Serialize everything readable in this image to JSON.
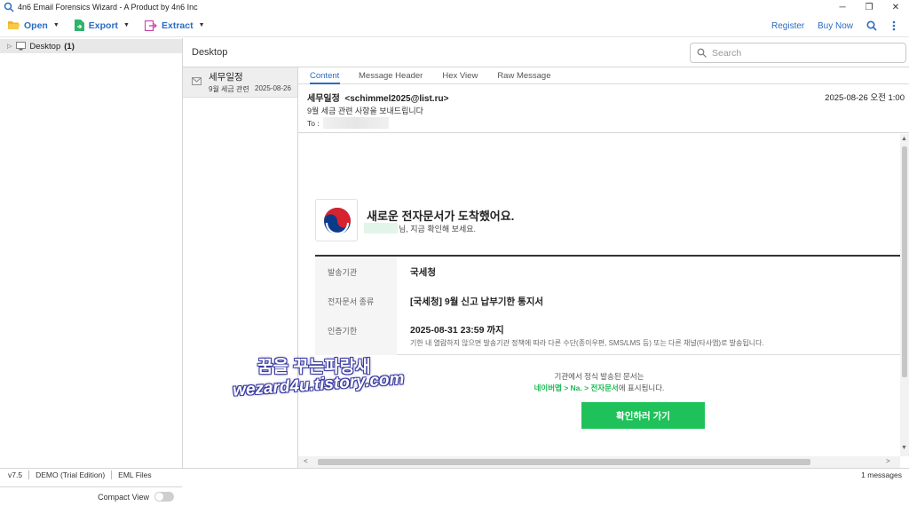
{
  "window": {
    "title": "4n6 Email Forensics Wizard - A Product by 4n6 Inc",
    "controls": {
      "minimize": "─",
      "maximize": "❐",
      "close": "✕"
    }
  },
  "toolbar": {
    "open_label": "Open",
    "export_label": "Export",
    "extract_label": "Extract",
    "register_label": "Register",
    "buy_label": "Buy Now"
  },
  "tree": {
    "root_label": "Desktop",
    "root_count": "(1)"
  },
  "compact_view_label": "Compact View",
  "path_label": "Desktop",
  "search": {
    "placeholder": "Search"
  },
  "message_list": [
    {
      "sender": "세무일정",
      "subject": "9월 세금 관련",
      "date": "2025-08-26"
    }
  ],
  "tabs": [
    "Content",
    "Message Header",
    "Hex View",
    "Raw Message"
  ],
  "header": {
    "from_name": "세무일정",
    "from_email": "<schimmel2025@list.ru>",
    "date": "2025-08-26 오전 1:00",
    "subject": "9월 세금 관련 사항을 보내드립니다",
    "to_label": "To :"
  },
  "email": {
    "notice_title": "새로운 전자문서가 도착했어요.",
    "notice_sub": "님, 지금 확인해 보세요.",
    "rows": [
      {
        "label": "발송기관",
        "value": "국세청"
      },
      {
        "label": "전자문서 종류",
        "value": "[국세청] 9월 신고 납부기한 통지서"
      },
      {
        "label": "인증기한",
        "value": "2025-08-31 23:59 까지"
      }
    ],
    "note": "기한 내 열람하지 않으면 발송기관 정책에 따라 다른 수단(종이우편, SMS/LMS 등) 또는 다른 채널(타사앱)로 발송됩니다.",
    "footer_line1": "기관에서 정식 발송된 문서는",
    "footer_green": "네이버앱 > Na. > 전자문서",
    "footer_rest": "에 표시됩니다.",
    "button_label": "확인하러 가기"
  },
  "watermark": {
    "line1": "꿈을 꾸는파랑새",
    "line2": "wezard4u.tistory.com"
  },
  "status": {
    "version": "v7.5",
    "edition": "DEMO (Trial Edition)",
    "file_type": "EML Files",
    "count": "1 messages"
  },
  "colors": {
    "accent": "#2a6cc4",
    "confirm_button": "#1fc25a",
    "green_text": "#1db954"
  }
}
